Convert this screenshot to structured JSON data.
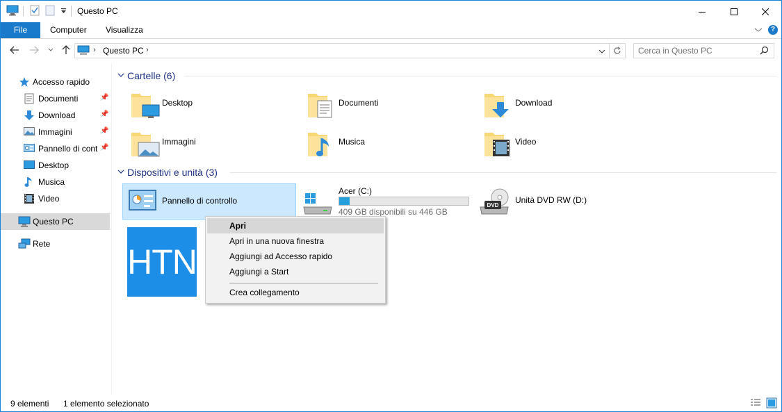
{
  "window": {
    "title": "Questo PC",
    "accent": "#1979ca"
  },
  "ribbon": {
    "tabs": [
      {
        "label": "File"
      },
      {
        "label": "Computer"
      },
      {
        "label": "Visualizza"
      }
    ]
  },
  "address": {
    "path": [
      "Questo PC"
    ],
    "search_placeholder": "Cerca in Questo PC"
  },
  "sidebar": {
    "quick_access": "Accesso rapido",
    "items": [
      {
        "label": "Documenti",
        "icon": "documents-icon",
        "pinned": true
      },
      {
        "label": "Download",
        "icon": "download-arrow-icon",
        "pinned": true
      },
      {
        "label": "Immagini",
        "icon": "pictures-icon",
        "pinned": true
      },
      {
        "label": "Pannello di cont",
        "icon": "control-panel-icon",
        "pinned": true
      },
      {
        "label": "Desktop",
        "icon": "desktop-icon",
        "pinned": false
      },
      {
        "label": "Musica",
        "icon": "music-note-icon",
        "pinned": false
      },
      {
        "label": "Video",
        "icon": "video-film-icon",
        "pinned": false
      }
    ],
    "this_pc": "Questo PC",
    "network": "Rete"
  },
  "folders": {
    "heading": "Cartelle (6)",
    "items": [
      {
        "label": "Desktop"
      },
      {
        "label": "Documenti"
      },
      {
        "label": "Download"
      },
      {
        "label": "Immagini"
      },
      {
        "label": "Musica"
      },
      {
        "label": "Video"
      }
    ]
  },
  "devices": {
    "heading": "Dispositivi e unità (3)",
    "control_panel": "Pannello di controllo",
    "drive_c": {
      "label": "Acer (C:)",
      "space": "409 GB disponibili su 446 GB",
      "used_fraction": 0.083
    },
    "dvd": {
      "label": "Unità DVD RW (D:)",
      "badge": "DVD"
    }
  },
  "tile_logo": "HTN",
  "context_menu": {
    "items": [
      {
        "label": "Apri"
      },
      {
        "label": "Apri in una nuova finestra"
      },
      {
        "label": "Aggiungi ad Accesso rapido"
      },
      {
        "label": "Aggiungi a Start"
      },
      {
        "label": "Crea collegamento"
      }
    ]
  },
  "status": {
    "count": "9 elementi",
    "selection": "1 elemento selezionato"
  }
}
